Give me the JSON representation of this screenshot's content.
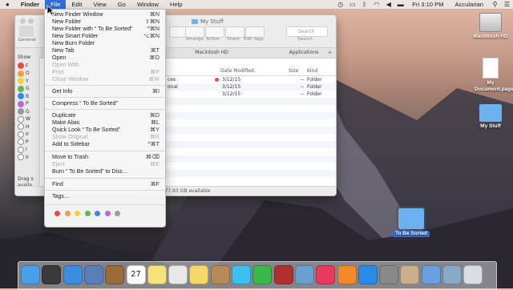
{
  "menubar": {
    "apple_icon": "apple-icon",
    "items": [
      "Finder",
      "File",
      "Edit",
      "View",
      "Go",
      "Window",
      "Help"
    ],
    "active_index": 1,
    "clock": "Fri 3:10 PM",
    "user": "Accularian"
  },
  "window": {
    "title": "My Stuff",
    "toolbar_labels": [
      "Arrange",
      "Action",
      "Share",
      "Edit Tags",
      "Search"
    ],
    "search_placeholder": "Search",
    "sidebar_partial": [
      "General",
      "Show"
    ],
    "tab_labels": [
      "Macintosh HD",
      "Applications"
    ],
    "columns": [
      "Date Modified",
      "Size",
      "Kind"
    ],
    "rows": [
      {
        "name_fragment": "ces",
        "date": "3/12/15",
        "size": "--",
        "kind": "Folder",
        "tag_color": "#e84a4a"
      },
      {
        "name_fragment": "onal",
        "date": "3/12/15",
        "size": "--",
        "kind": "Folder",
        "tag_color": ""
      },
      {
        "name_fragment": "",
        "date": "3/12/15",
        "size": "--",
        "kind": "Folder",
        "tag_color": ""
      }
    ],
    "sidebar_footer": [
      "Drag s",
      "availa"
    ],
    "status": "5 items, 977.93 GB available",
    "sidebar_tag_colors": [
      "#e84a4a",
      "#f0a03a",
      "#f4d13b",
      "#5dbb4d",
      "#3a86e8",
      "#b56ad4",
      "#999999",
      "#ffffff",
      "#ffffff",
      "#ffffff",
      "#ffffff",
      "#ffffff",
      "#ffffff"
    ],
    "sidebar_tag_initials": [
      "F",
      "O",
      "Y",
      "G",
      "B",
      "P",
      "G",
      "W",
      "H",
      "Ir",
      "P",
      "I",
      "Ir"
    ]
  },
  "file_menu": {
    "items": [
      {
        "label": "New Finder Window",
        "shortcut": "⌘N",
        "enabled": true
      },
      {
        "label": "New Folder",
        "shortcut": "⇧⌘N",
        "enabled": true
      },
      {
        "label": "New Folder with “ To Be Sorted”",
        "shortcut": "^⌘N",
        "enabled": true
      },
      {
        "label": "New Smart Folder",
        "shortcut": "⌥⌘N",
        "enabled": true
      },
      {
        "label": "New Burn Folder",
        "shortcut": "",
        "enabled": true
      },
      {
        "label": "New Tab",
        "shortcut": "⌘T",
        "enabled": true
      },
      {
        "label": "Open",
        "shortcut": "⌘O",
        "enabled": true
      },
      {
        "label": "Open With",
        "shortcut": "",
        "enabled": false
      },
      {
        "label": "Print",
        "shortcut": "⌘P",
        "enabled": false
      },
      {
        "label": "Close Window",
        "shortcut": "⌘W",
        "enabled": false
      },
      {
        "label": "Get Info",
        "shortcut": "⌘I",
        "enabled": true
      },
      {
        "label": "Compress “ To Be Sorted”",
        "shortcut": "",
        "enabled": true
      },
      {
        "label": "Duplicate",
        "shortcut": "⌘D",
        "enabled": true
      },
      {
        "label": "Make Alias",
        "shortcut": "⌘L",
        "enabled": true
      },
      {
        "label": "Quick Look “ To Be Sorted”",
        "shortcut": "⌘Y",
        "enabled": true
      },
      {
        "label": "Show Original",
        "shortcut": "⌘R",
        "enabled": false
      },
      {
        "label": "Add to Sidebar",
        "shortcut": "^⌘T",
        "enabled": true
      },
      {
        "label": "Move to Trash",
        "shortcut": "⌘⌫",
        "enabled": true
      },
      {
        "label": "Eject",
        "shortcut": "⌘E",
        "enabled": false
      },
      {
        "label": "Burn “ To Be Sorted” to Disc…",
        "shortcut": "",
        "enabled": true
      },
      {
        "label": "Find",
        "shortcut": "⌘F",
        "enabled": true
      },
      {
        "label": "Tags…",
        "shortcut": "",
        "enabled": true
      }
    ],
    "tag_colors": [
      "#e84a4a",
      "#f0a03a",
      "#f4d13b",
      "#5dbb4d",
      "#3a86e8",
      "#b56ad4",
      "#9a9a9a"
    ]
  },
  "desktop": {
    "icons": [
      {
        "label": "Macintosh HD",
        "name": "hard-drive-icon"
      },
      {
        "label": "My Document.pages",
        "name": "pages-document-icon"
      },
      {
        "label": "My Stuff",
        "name": "folder-icon"
      },
      {
        "label": "To Be Sorted",
        "name": "folder-icon"
      }
    ]
  },
  "dock": {
    "icons": [
      "finder-icon",
      "mission-control-icon",
      "safari-icon",
      "preview-icon",
      "notes-book-icon",
      "calendar-icon",
      "stickies-icon",
      "photos-icon",
      "notes-icon",
      "contacts-icon",
      "messages-icon",
      "facetime-icon",
      "photo-booth-icon",
      "iphoto-icon",
      "itunes-icon",
      "ibooks-icon",
      "app-store-icon",
      "system-preferences-icon",
      "mail-icon",
      "downloads-icon",
      "documents-icon",
      "trash-icon"
    ],
    "calendar_day": "27"
  }
}
